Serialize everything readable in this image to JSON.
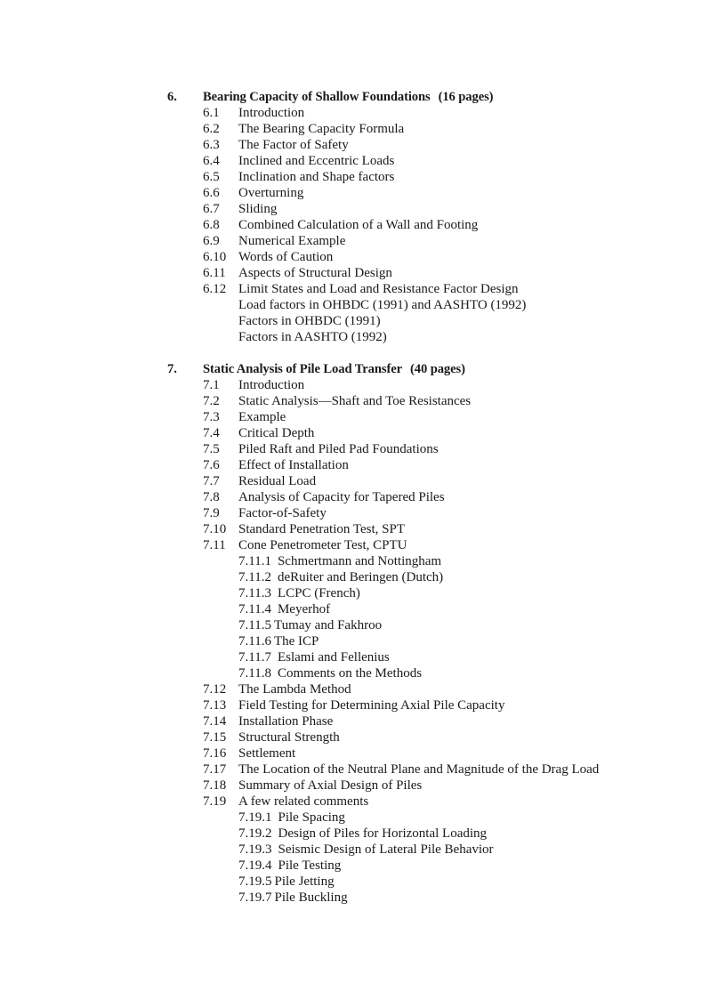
{
  "document": {
    "type": "table-of-contents"
  },
  "chapters": [
    {
      "number": "6.",
      "title": "Bearing Capacity of Shallow Foundations",
      "pages": "(16 pages)",
      "entries": [
        {
          "kind": "numbered",
          "num": "6.1",
          "title": "Introduction"
        },
        {
          "kind": "numbered",
          "num": "6.2",
          "title": "The Bearing Capacity Formula"
        },
        {
          "kind": "numbered",
          "num": "6.3",
          "title": "The Factor of Safety"
        },
        {
          "kind": "numbered",
          "num": "6.4",
          "title": "Inclined and Eccentric Loads"
        },
        {
          "kind": "numbered",
          "num": "6.5",
          "title": "Inclination and Shape factors"
        },
        {
          "kind": "numbered",
          "num": "6.6",
          "title": "Overturning"
        },
        {
          "kind": "numbered",
          "num": "6.7",
          "title": "Sliding"
        },
        {
          "kind": "numbered",
          "num": "6.8",
          "title": "Combined Calculation of a Wall and Footing"
        },
        {
          "kind": "numbered",
          "num": "6.9",
          "title": "Numerical Example"
        },
        {
          "kind": "numbered",
          "num": "6.10",
          "title": "Words of Caution"
        },
        {
          "kind": "numbered",
          "num": "6.11",
          "title": "Aspects of Structural Design"
        },
        {
          "kind": "numbered",
          "num": "6.12",
          "title": "Limit States and Load and Resistance Factor Design"
        },
        {
          "kind": "continuation",
          "num": "",
          "title": "Load factors in OHBDC (1991) and AASHTO (1992)"
        },
        {
          "kind": "continuation",
          "num": "",
          "title": "Factors in OHBDC (1991)"
        },
        {
          "kind": "continuation",
          "num": "",
          "title": "Factors in AASHTO (1992)"
        }
      ]
    },
    {
      "number": "7.",
      "title": "Static Analysis of Pile Load Transfer",
      "pages": "(40 pages)",
      "entries": [
        {
          "kind": "numbered",
          "num": "7.1",
          "title": "Introduction"
        },
        {
          "kind": "numbered",
          "num": "7.2",
          "title": "Static Analysis—Shaft and Toe Resistances"
        },
        {
          "kind": "numbered",
          "num": "7.3",
          "title": "Example"
        },
        {
          "kind": "numbered",
          "num": "7.4",
          "title": "Critical Depth"
        },
        {
          "kind": "numbered",
          "num": "7.5",
          "title": "Piled Raft and Piled Pad Foundations"
        },
        {
          "kind": "numbered",
          "num": "7.6",
          "title": "Effect of Installation"
        },
        {
          "kind": "numbered",
          "num": "7.7",
          "title": "Residual Load"
        },
        {
          "kind": "numbered",
          "num": "7.8",
          "title": "Analysis of Capacity for Tapered Piles"
        },
        {
          "kind": "numbered",
          "num": "7.9",
          "title": "Factor-of-Safety"
        },
        {
          "kind": "numbered",
          "num": "7.10",
          "title": "Standard Penetration Test, SPT"
        },
        {
          "kind": "numbered",
          "num": "7.11",
          "title": "Cone Penetrometer Test, CPTU"
        },
        {
          "kind": "sub",
          "num": "7.11.1",
          "title": "Schmertmann and Nottingham",
          "gap": "wide"
        },
        {
          "kind": "sub",
          "num": "7.11.2",
          "title": "deRuiter and Beringen (Dutch)",
          "gap": "wide"
        },
        {
          "kind": "sub",
          "num": "7.11.3",
          "title": "LCPC (French)",
          "gap": "wide"
        },
        {
          "kind": "sub",
          "num": "7.11.4",
          "title": "Meyerhof",
          "gap": "wide"
        },
        {
          "kind": "sub",
          "num": "7.11.5",
          "title": "Tumay and Fakhroo",
          "gap": "narrow"
        },
        {
          "kind": "sub",
          "num": "7.11.6",
          "title": "The ICP",
          "gap": "narrow"
        },
        {
          "kind": "sub",
          "num": "7.11.7",
          "title": "Eslami and Fellenius",
          "gap": "wide"
        },
        {
          "kind": "sub",
          "num": "7.11.8",
          "title": "Comments on the Methods",
          "gap": "wide"
        },
        {
          "kind": "numbered",
          "num": "7.12",
          "title": "The Lambda Method"
        },
        {
          "kind": "numbered",
          "num": "7.13",
          "title": "Field Testing for Determining Axial Pile Capacity"
        },
        {
          "kind": "numbered",
          "num": "7.14",
          "title": "Installation Phase"
        },
        {
          "kind": "numbered",
          "num": "7.15",
          "title": "Structural Strength"
        },
        {
          "kind": "numbered",
          "num": "7.16",
          "title": "Settlement"
        },
        {
          "kind": "numbered",
          "num": "7.17",
          "title": "The Location of the Neutral Plane and Magnitude of the Drag Load"
        },
        {
          "kind": "numbered",
          "num": "7.18",
          "title": "Summary of Axial Design of Piles"
        },
        {
          "kind": "numbered",
          "num": "7.19",
          "title": "A few related comments"
        },
        {
          "kind": "sub",
          "num": "7.19.1",
          "title": "Pile Spacing",
          "gap": "wide"
        },
        {
          "kind": "sub",
          "num": "7.19.2",
          "title": "Design of Piles for Horizontal Loading",
          "gap": "wide"
        },
        {
          "kind": "sub",
          "num": "7.19.3",
          "title": "Seismic Design of Lateral Pile Behavior",
          "gap": "wide"
        },
        {
          "kind": "sub",
          "num": "7.19.4",
          "title": "Pile Testing",
          "gap": "wide"
        },
        {
          "kind": "sub",
          "num": "7.19.5",
          "title": "Pile Jetting",
          "gap": "narrow"
        },
        {
          "kind": "sub",
          "num": "7.19.7",
          "title": "Pile Buckling",
          "gap": "narrow"
        }
      ]
    }
  ]
}
